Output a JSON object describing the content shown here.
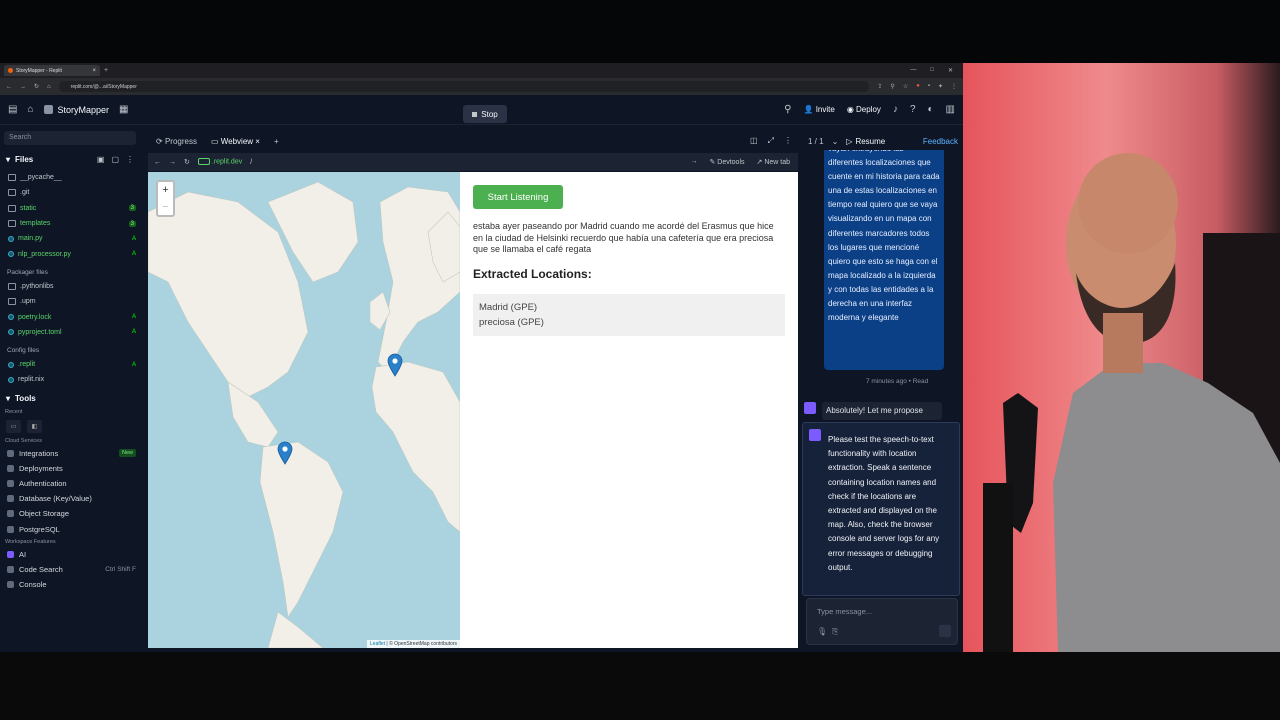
{
  "browser": {
    "tab_title": "StoryMapper - Replit",
    "url": "replit.com/@...ai/StoryMapper"
  },
  "appbar": {
    "project": "StoryMapper",
    "stop_label": "Stop",
    "invite_label": "Invite",
    "deploy_label": "Deploy"
  },
  "sidebar": {
    "search_placeholder": "Search",
    "files_title": "Files",
    "files": [
      {
        "name": "__pycache__",
        "badge": ""
      },
      {
        "name": ".git",
        "badge": ""
      },
      {
        "name": "static",
        "badge": "3"
      },
      {
        "name": "templates",
        "badge": "3"
      },
      {
        "name": "main.py",
        "badge": "A"
      },
      {
        "name": "nlp_processor.py",
        "badge": "A"
      }
    ],
    "packager_title": "Packager files",
    "packager_files": [
      {
        "name": ".pythonlibs",
        "badge": ""
      },
      {
        "name": ".upm",
        "badge": ""
      },
      {
        "name": "poetry.lock",
        "badge": "A"
      },
      {
        "name": "pyproject.toml",
        "badge": "A"
      }
    ],
    "config_title": "Config files",
    "config_files": [
      {
        "name": ".replit",
        "badge": "A"
      },
      {
        "name": "replit.nix",
        "badge": ""
      }
    ],
    "tools_title": "Tools",
    "recent_label": "Recent",
    "cloud_label": "Cloud Services",
    "cloud_items": [
      "Integrations",
      "Deployments",
      "Authentication",
      "Database (Key/Value)",
      "Object Storage",
      "PostgreSQL"
    ],
    "new_badge": "New",
    "workspace_label": "Workspace Features",
    "workspace_items": [
      "AI",
      "Code Search",
      "Console"
    ],
    "code_search_kbd": "Ctrl Shift F"
  },
  "panel_tabs": {
    "progress": "Progress",
    "webview": "Webview"
  },
  "webview_bar": {
    "url": ".replit.dev",
    "path": "/",
    "devtools": "Devtools",
    "new_tab": "New tab"
  },
  "app": {
    "start_button": "Start Listening",
    "transcript": "estaba ayer paseando por Madrid cuando me acordé del Erasmus que hice en la ciudad de Helsinki recuerdo que había una cafetería que era preciosa que se llamaba el café regata",
    "extracted_title": "Extracted Locations:",
    "locations": [
      "Madrid (GPE)",
      "preciosa (GPE)"
    ],
    "attribution_leaflet": "Leaflet",
    "attribution_osm": "© OpenStreetMap contributors"
  },
  "agent": {
    "pager": "1 / 1",
    "resume": "Resume",
    "feedback": "Feedback",
    "user_message": "vayan extrayendo las diferentes localizaciones que cuente en mi historia para cada una de estas localizaciones en tiempo real quiero que se vaya visualizando en un mapa con diferentes marcadores todos los lugares que mencioné quiero que esto se haga con el mapa localizado a la izquierda y con todas las entidades a la derecha en una interfaz moderna y elegante",
    "message_time": "7 minutes ago • Read",
    "ai_reply": "Absolutely! Let me propose",
    "task_text": "Please test the speech-to-text functionality with location extraction. Speak a sentence containing location names and check if the locations are extracted and displayed on the map. Also, check the browser console and server logs for any error messages or debugging output.",
    "input_placeholder": "Type message..."
  },
  "colors": {
    "ide_bg": "#0e1525",
    "accent_green": "#4caf50",
    "user_bubble": "#0b3f86",
    "map_water": "#aad3df",
    "marker": "#2a81cb"
  }
}
